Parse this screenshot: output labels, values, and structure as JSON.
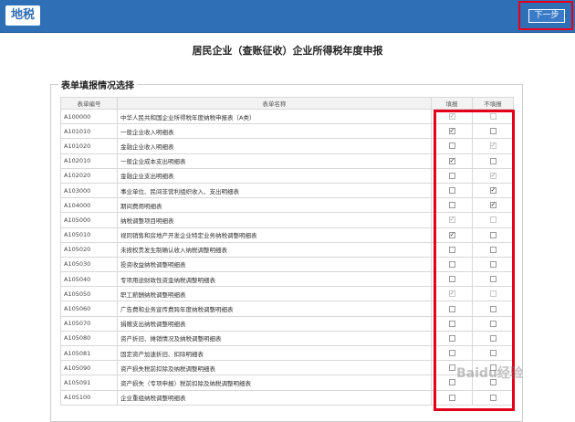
{
  "header": {
    "logo": "地税",
    "next_button": "下一步"
  },
  "page_title": "居民企业（查账征收）企业所得税年度申报",
  "section_title": "表单填报情况选择",
  "table": {
    "headers": [
      "表单编号",
      "表单名称",
      "填报",
      "不填报"
    ],
    "rows": [
      {
        "code": "A100000",
        "name": "中华人民共和国企业所得税年度纳税申报表（A类）",
        "fill": "dim-checked",
        "nofill": "dim"
      },
      {
        "code": "A101010",
        "name": "一般企业收入明细表",
        "fill": "checked",
        "nofill": "empty"
      },
      {
        "code": "A101020",
        "name": "金融企业收入明细表",
        "fill": "empty",
        "nofill": "dim-checked"
      },
      {
        "code": "A102010",
        "name": "一般企业成本支出明细表",
        "fill": "checked",
        "nofill": "empty"
      },
      {
        "code": "A102020",
        "name": "金融企业支出明细表",
        "fill": "empty",
        "nofill": "dim-checked"
      },
      {
        "code": "A103000",
        "name": "事业单位、民间非营利组织收入、支出明细表",
        "fill": "empty",
        "nofill": "checked"
      },
      {
        "code": "A104000",
        "name": "期间费用明细表",
        "fill": "empty",
        "nofill": "checked"
      },
      {
        "code": "A105000",
        "name": "纳税调整项目明细表",
        "fill": "dim-checked",
        "nofill": "dim"
      },
      {
        "code": "A105010",
        "name": "视同销售和房地产开发企业特定业务纳税调整明细表",
        "fill": "checked",
        "nofill": "empty"
      },
      {
        "code": "A105020",
        "name": "未按权责发生制确认收入纳税调整明细表",
        "fill": "empty",
        "nofill": "empty"
      },
      {
        "code": "A105030",
        "name": "投资收益纳税调整明细表",
        "fill": "empty",
        "nofill": "empty"
      },
      {
        "code": "A105040",
        "name": "专项用途财政性资金纳税调整明细表",
        "fill": "empty",
        "nofill": "empty"
      },
      {
        "code": "A105050",
        "name": "职工薪酬纳税调整明细表",
        "fill": "dim-checked",
        "nofill": "dim"
      },
      {
        "code": "A105060",
        "name": "广告费和业务宣传费跨年度纳税调整明细表",
        "fill": "empty",
        "nofill": "empty"
      },
      {
        "code": "A105070",
        "name": "捐赠支出纳税调整明细表",
        "fill": "empty",
        "nofill": "empty"
      },
      {
        "code": "A105080",
        "name": "资产折旧、摊销情况及纳税调整明细表",
        "fill": "empty",
        "nofill": "empty"
      },
      {
        "code": "A105081",
        "name": "固定资产加速折旧、扣除明细表",
        "fill": "empty",
        "nofill": "empty"
      },
      {
        "code": "A105090",
        "name": "资产损失税前扣除及纳税调整明细表",
        "fill": "empty",
        "nofill": "empty"
      },
      {
        "code": "A105091",
        "name": "资产损失（专项申报）税前扣除及纳税调整明细表",
        "fill": "empty",
        "nofill": "empty"
      },
      {
        "code": "A105100",
        "name": "企业重组纳税调整明细表",
        "fill": "empty",
        "nofill": "empty"
      }
    ]
  },
  "watermark": "Baidu经验",
  "colors": {
    "header_blue": "#2f6fb5",
    "highlight_red": "#e3001b"
  }
}
